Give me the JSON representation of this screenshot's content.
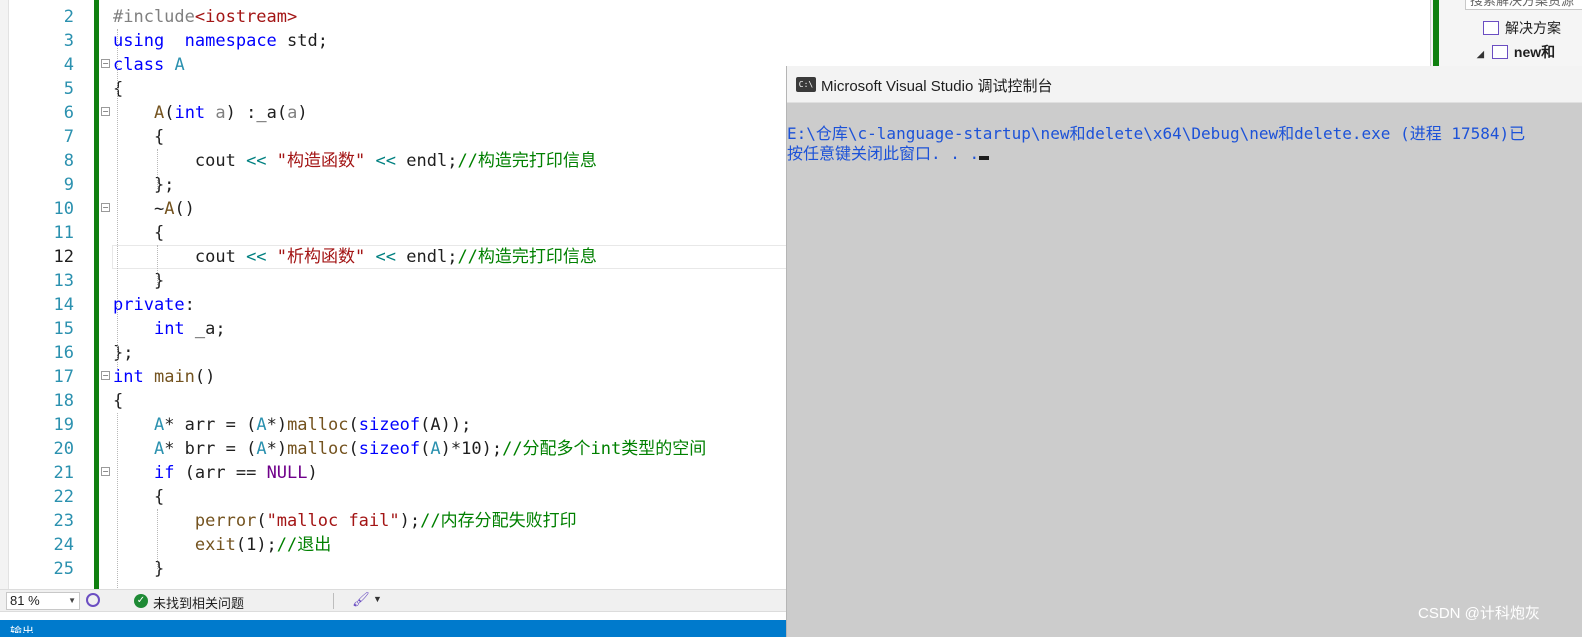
{
  "editor": {
    "current_line": 12,
    "lines": [
      {
        "n": 2,
        "tokens": [
          [
            "pre",
            "#include"
          ],
          [
            "str",
            "<iostream>"
          ]
        ]
      },
      {
        "n": 3,
        "tokens": [
          [
            "kw",
            "using"
          ],
          [
            "",
            "  "
          ],
          [
            "kw",
            "namespace"
          ],
          [
            "",
            " std;"
          ]
        ]
      },
      {
        "n": 4,
        "tokens": [
          [
            "kw",
            "class"
          ],
          [
            "",
            " "
          ],
          [
            "ty",
            "A"
          ]
        ]
      },
      {
        "n": 5,
        "tokens": [
          [
            "",
            "{"
          ]
        ]
      },
      {
        "n": 6,
        "tokens": [
          [
            "",
            "    "
          ],
          [
            "fn",
            "A"
          ],
          [
            "",
            "("
          ],
          [
            "kw",
            "int"
          ],
          [
            "",
            " "
          ],
          [
            "pa",
            "a"
          ],
          [
            "",
            ")"
          ],
          [
            "",
            " :_a("
          ],
          [
            "pa",
            "a"
          ],
          [
            "",
            ")"
          ]
        ]
      },
      {
        "n": 7,
        "tokens": [
          [
            "",
            "    {"
          ]
        ]
      },
      {
        "n": 8,
        "tokens": [
          [
            "",
            "        cout "
          ],
          [
            "op",
            "<<"
          ],
          [
            "",
            " "
          ],
          [
            "str",
            "\"构造函数\""
          ],
          [
            "",
            " "
          ],
          [
            "op",
            "<<"
          ],
          [
            "",
            " endl;"
          ],
          [
            "cm",
            "//构造完打印信息"
          ]
        ]
      },
      {
        "n": 9,
        "tokens": [
          [
            "",
            "    };"
          ]
        ]
      },
      {
        "n": 10,
        "tokens": [
          [
            "",
            "    ~"
          ],
          [
            "fn",
            "A"
          ],
          [
            "",
            "()"
          ]
        ]
      },
      {
        "n": 11,
        "tokens": [
          [
            "",
            "    {"
          ]
        ]
      },
      {
        "n": 12,
        "tokens": [
          [
            "",
            "        cout "
          ],
          [
            "op",
            "<<"
          ],
          [
            "",
            " "
          ],
          [
            "str",
            "\"析构函数\""
          ],
          [
            "",
            " "
          ],
          [
            "op",
            "<<"
          ],
          [
            "",
            " endl;"
          ],
          [
            "cm",
            "//构造完打印信息"
          ]
        ]
      },
      {
        "n": 13,
        "tokens": [
          [
            "",
            "    }"
          ]
        ]
      },
      {
        "n": 14,
        "tokens": [
          [
            "kw",
            "private"
          ],
          [
            "",
            ":"
          ]
        ]
      },
      {
        "n": 15,
        "tokens": [
          [
            "",
            "    "
          ],
          [
            "kw",
            "int"
          ],
          [
            "",
            " _a;"
          ]
        ]
      },
      {
        "n": 16,
        "tokens": [
          [
            "",
            "};"
          ]
        ]
      },
      {
        "n": 17,
        "tokens": [
          [
            "kw",
            "int"
          ],
          [
            "",
            " "
          ],
          [
            "fn",
            "main"
          ],
          [
            "",
            "()"
          ]
        ]
      },
      {
        "n": 18,
        "tokens": [
          [
            "",
            "{"
          ]
        ]
      },
      {
        "n": 19,
        "tokens": [
          [
            "",
            "    "
          ],
          [
            "ty",
            "A"
          ],
          [
            "",
            "* arr = ("
          ],
          [
            "ty",
            "A"
          ],
          [
            "",
            "*)"
          ],
          [
            "fn",
            "malloc"
          ],
          [
            "",
            "("
          ],
          [
            "kw",
            "sizeof"
          ],
          [
            "",
            "(A));"
          ]
        ]
      },
      {
        "n": 20,
        "tokens": [
          [
            "",
            "    "
          ],
          [
            "ty",
            "A"
          ],
          [
            "",
            "* brr = ("
          ],
          [
            "ty",
            "A"
          ],
          [
            "",
            "*)"
          ],
          [
            "fn",
            "malloc"
          ],
          [
            "",
            "("
          ],
          [
            "kw",
            "sizeof"
          ],
          [
            "",
            "("
          ],
          [
            "ty",
            "A"
          ],
          [
            "",
            ")*10);"
          ],
          [
            "cm",
            "//分配多个int类型的空间"
          ]
        ]
      },
      {
        "n": 21,
        "tokens": [
          [
            "",
            "    "
          ],
          [
            "kw",
            "if"
          ],
          [
            "",
            " (arr == "
          ],
          [
            "mac",
            "NULL"
          ],
          [
            "",
            ")"
          ]
        ]
      },
      {
        "n": 22,
        "tokens": [
          [
            "",
            "    {"
          ]
        ]
      },
      {
        "n": 23,
        "tokens": [
          [
            "",
            "        "
          ],
          [
            "fn",
            "perror"
          ],
          [
            "",
            "("
          ],
          [
            "str",
            "\"malloc fail\""
          ],
          [
            "",
            ");"
          ],
          [
            "cm",
            "//内存分配失败打印"
          ]
        ]
      },
      {
        "n": 24,
        "tokens": [
          [
            "",
            "        "
          ],
          [
            "fn",
            "exit"
          ],
          [
            "",
            "(1);"
          ],
          [
            "cm",
            "//退出"
          ]
        ]
      },
      {
        "n": 25,
        "tokens": [
          [
            "",
            "    }"
          ]
        ]
      }
    ]
  },
  "status": {
    "zoom": "81 %",
    "issues_text": "未找到相关问题"
  },
  "output": {
    "tab_label": "输出"
  },
  "solution_explorer": {
    "search_placeholder": "搜索解决方案资源",
    "item_solution": "解决方案",
    "item_project": "new和"
  },
  "console": {
    "icon_text": "C:\\",
    "title": "Microsoft Visual Studio 调试控制台",
    "lines": [
      "E:\\仓库\\c-language-startup\\new和delete\\x64\\Debug\\new和delete.exe (进程 17584)已",
      "按任意键关闭此窗口. . ."
    ]
  },
  "watermark": "CSDN @计科炮灰",
  "colors": {
    "keyword": "#0000ff",
    "type": "#2b91af",
    "string": "#a31515",
    "comment": "#008000",
    "console_text": "#1c52d8",
    "console_bg": "#cccccc",
    "change_bar": "#108010",
    "output_bar": "#007acc"
  }
}
